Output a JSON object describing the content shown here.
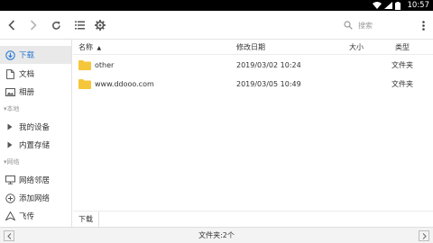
{
  "statusbar": {
    "time": "10:57",
    "icons": [
      "wifi-icon",
      "signal-icon",
      "battery-icon"
    ]
  },
  "toolbar": {
    "back": "back-icon",
    "forward": "forward-icon",
    "refresh": "refresh-icon",
    "list_view": "list-view-icon",
    "settings": "gear-icon",
    "search_placeholder": "搜索",
    "more": "more-vertical-icon"
  },
  "sidebar": {
    "items": [
      {
        "label": "下载",
        "icon": "download-icon",
        "active": true
      },
      {
        "label": "文档",
        "icon": "document-icon"
      },
      {
        "label": "相册",
        "icon": "image-icon"
      }
    ],
    "sections": [
      {
        "title": "本地",
        "items": [
          {
            "label": "我的设备"
          },
          {
            "label": "内置存储"
          }
        ]
      },
      {
        "title": "网络",
        "items": [
          {
            "label": "网络邻居"
          },
          {
            "label": "添加网络"
          },
          {
            "label": "飞传"
          }
        ]
      }
    ]
  },
  "table": {
    "columns": {
      "name": "名称",
      "modified": "修改日期",
      "size": "大小",
      "type": "类型"
    },
    "sort_indicator": "▲",
    "rows": [
      {
        "name": "other",
        "modified": "2019/03/02 10:24",
        "size": "",
        "type": "文件夹"
      },
      {
        "name": "www.ddooo.com",
        "modified": "2019/03/05 10:49",
        "size": "",
        "type": "文件夹"
      }
    ]
  },
  "pathbar": {
    "segment": "下载"
  },
  "footer": {
    "status": "文件夹:2个"
  },
  "colors": {
    "accent": "#2a7ad3",
    "folder": "#f6c63a",
    "statusbar": "#000000"
  }
}
